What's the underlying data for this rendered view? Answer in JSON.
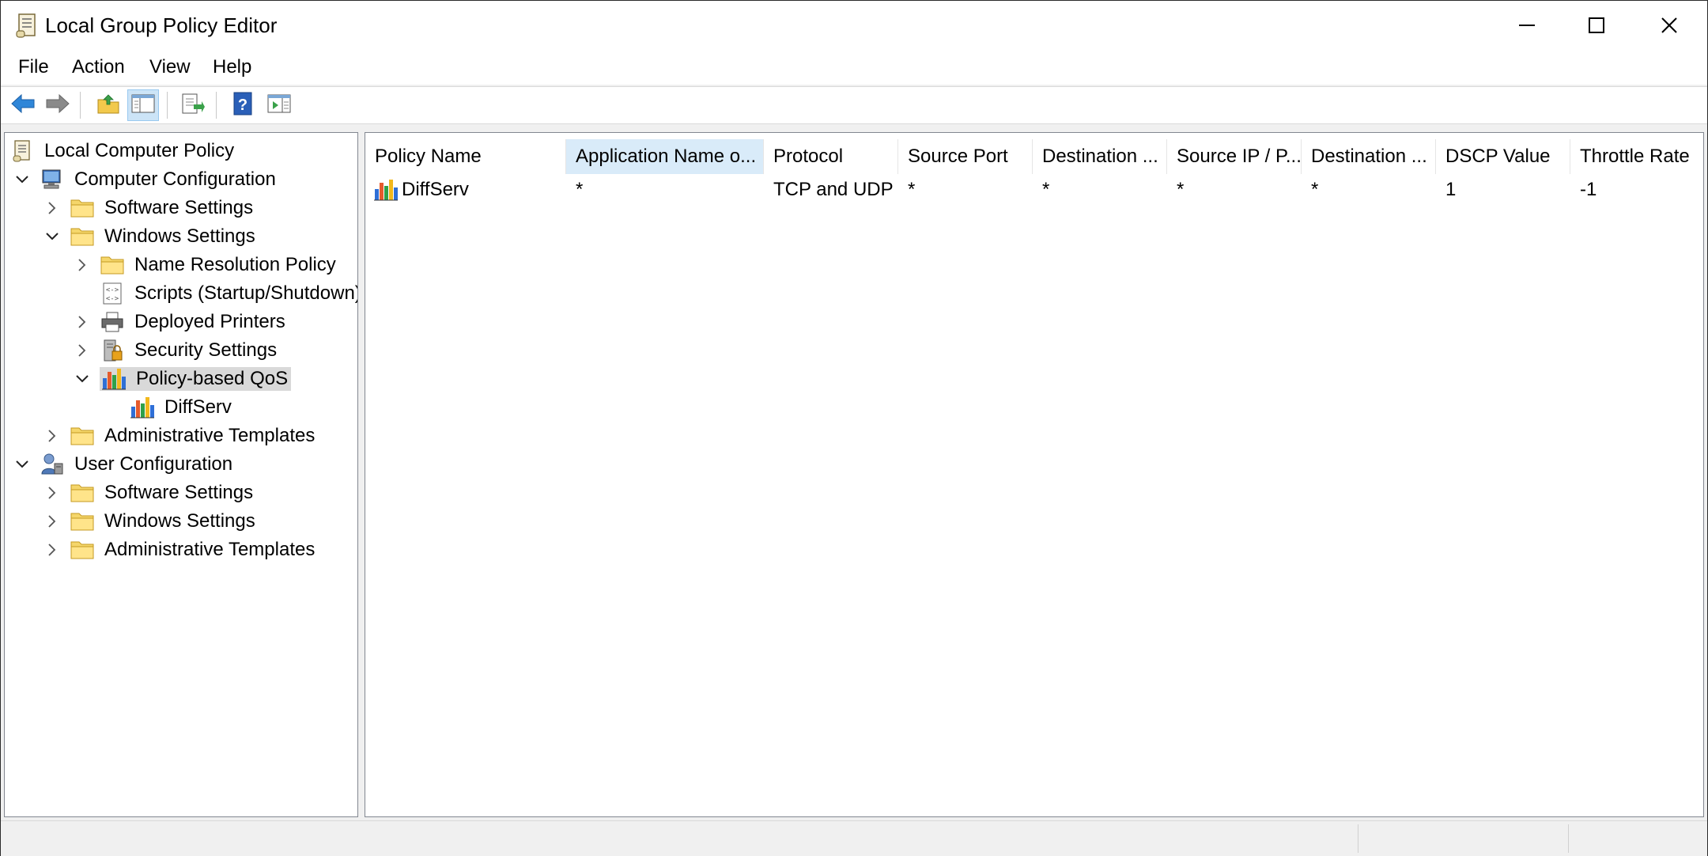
{
  "window": {
    "title": "Local Group Policy Editor",
    "controls": {
      "minimize": "minimize-icon",
      "maximize": "maximize-icon",
      "close": "close-icon"
    }
  },
  "menu": [
    "File",
    "Action",
    "View",
    "Help"
  ],
  "toolbar": {
    "buttons": [
      "back-arrow-icon",
      "forward-arrow-icon",
      "up-folder-icon",
      "show-hide-tree-icon",
      "export-list-icon",
      "help-icon",
      "show-hide-action-pane-icon"
    ],
    "active": "show-hide-tree-icon"
  },
  "tree": {
    "root": "Local Computer Policy",
    "items": [
      {
        "label": "Computer Configuration",
        "icon": "computer-icon",
        "expanded": true
      },
      {
        "label": "Software Settings",
        "icon": "folder-icon",
        "expanded": false
      },
      {
        "label": "Windows Settings",
        "icon": "folder-icon",
        "expanded": true
      },
      {
        "label": "Name Resolution Policy",
        "icon": "folder-icon",
        "expanded": false
      },
      {
        "label": "Scripts (Startup/Shutdown)",
        "icon": "script-icon"
      },
      {
        "label": "Deployed Printers",
        "icon": "printer-icon",
        "expanded": false
      },
      {
        "label": "Security Settings",
        "icon": "security-icon",
        "expanded": false
      },
      {
        "label": "Policy-based QoS",
        "icon": "qos-chart-icon",
        "expanded": true,
        "selected": true
      },
      {
        "label": "DiffServ",
        "icon": "qos-chart-icon"
      },
      {
        "label": "Administrative Templates",
        "icon": "folder-icon",
        "expanded": false
      },
      {
        "label": "User Configuration",
        "icon": "user-icon",
        "expanded": true
      },
      {
        "label": "Software Settings",
        "icon": "folder-icon",
        "expanded": false
      },
      {
        "label": "Windows Settings",
        "icon": "folder-icon",
        "expanded": false
      },
      {
        "label": "Administrative Templates",
        "icon": "folder-icon",
        "expanded": false
      }
    ]
  },
  "list": {
    "columns": [
      "Policy Name",
      "Application Name o...",
      "Protocol",
      "Source Port",
      "Destination ...",
      "Source IP / P...",
      "Destination ...",
      "DSCP Value",
      "Throttle Rate"
    ],
    "sorted_column": "Application Name o...",
    "rows": [
      [
        "DiffServ",
        "*",
        "TCP and UDP",
        "*",
        "*",
        "*",
        "*",
        "1",
        "-1"
      ]
    ]
  },
  "colors": {
    "selection": "#d9d9d9",
    "sorted_header": "#d9ebf9",
    "pane_border": "#828790"
  }
}
